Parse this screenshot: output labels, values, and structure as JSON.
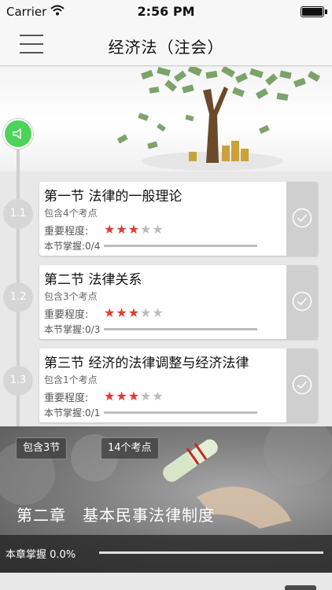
{
  "status_bar": {
    "carrier": "Carrier",
    "time": "2:56 PM",
    "battery_level": 1.0
  },
  "nav": {
    "title": "经济法（注会）",
    "menu_icon": "hamburger-menu-icon"
  },
  "audio": {
    "icon": "speaker-icon",
    "color": "#4cd35a"
  },
  "lessons": [
    {
      "number": "1.1",
      "title": "第一节 法律的一般理论",
      "count": "包含4个考点",
      "importance_label": "重要程度:",
      "stars": 3,
      "stars_max": 5,
      "mastery": "本节掌握:0/4",
      "progress": 0.0,
      "check_icon": "check-circle-icon"
    },
    {
      "number": "1.2",
      "title": "第二节 法律关系",
      "count": "包含3个考点",
      "importance_label": "重要程度:",
      "stars": 3,
      "stars_max": 5,
      "mastery": "本节掌握:0/3",
      "progress": 0.0,
      "check_icon": "check-circle-icon"
    },
    {
      "number": "1.3",
      "title": "第三节 经济的法律调整与经济法律",
      "count": "包含1个考点",
      "importance_label": "重要程度:",
      "stars": 3,
      "stars_max": 5,
      "mastery": "本节掌握:0/1",
      "progress": 0.0,
      "check_icon": "check-circle-icon"
    }
  ],
  "chapter": {
    "sections_badge": "包含3节",
    "points_badge": "14个考点",
    "title": "第二章　基本民事法律制度",
    "mastery_label": "本章掌握 0.0%",
    "progress": 0.0
  },
  "colors": {
    "accent": "#4cd35a",
    "star_on": "#e53935",
    "star_off": "#bdbdbd"
  }
}
